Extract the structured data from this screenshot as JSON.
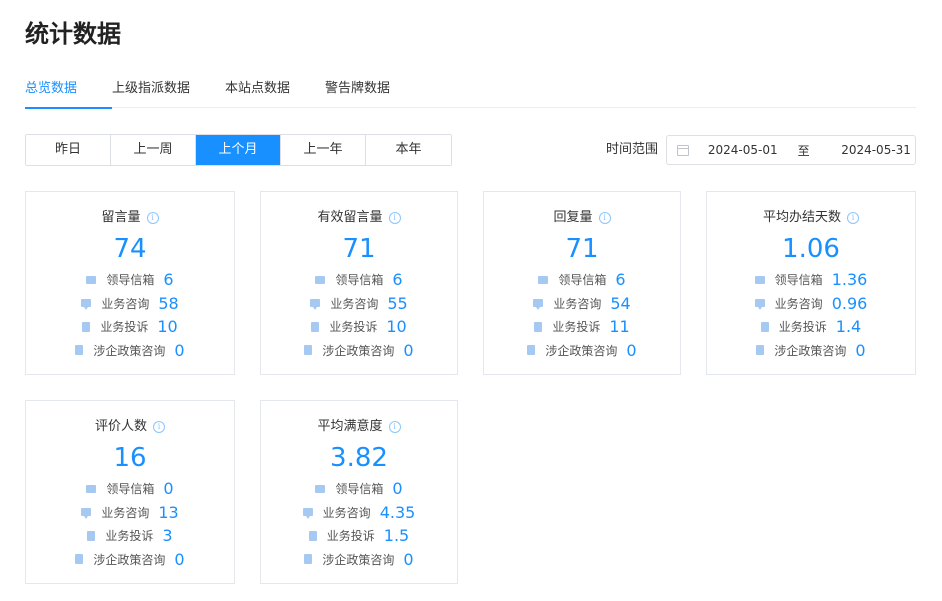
{
  "page": {
    "title": "统计数据"
  },
  "tabs": [
    {
      "label": "总览数据",
      "active": true
    },
    {
      "label": "上级指派数据",
      "active": false
    },
    {
      "label": "本站点数据",
      "active": false
    },
    {
      "label": "警告牌数据",
      "active": false
    }
  ],
  "period_buttons": [
    {
      "label": "昨日",
      "active": false
    },
    {
      "label": "上一周",
      "active": false
    },
    {
      "label": "上个月",
      "active": true
    },
    {
      "label": "上一年",
      "active": false
    },
    {
      "label": "本年",
      "active": false
    }
  ],
  "date_range": {
    "label": "时间范围",
    "start": "2024-05-01",
    "separator": "至",
    "end": "2024-05-31"
  },
  "colors": {
    "accent": "#1890ff",
    "border": "#e4e7ed",
    "icon": "#a6c9f2"
  },
  "row_icons": [
    "mail-icon",
    "chat-icon",
    "document-icon",
    "file-icon"
  ],
  "cards": [
    {
      "title": "留言量",
      "value": "74",
      "rows": [
        {
          "label": "领导信箱",
          "value": "6"
        },
        {
          "label": "业务咨询",
          "value": "58"
        },
        {
          "label": "业务投诉",
          "value": "10"
        },
        {
          "label": "涉企政策咨询",
          "value": "0"
        }
      ]
    },
    {
      "title": "有效留言量",
      "value": "71",
      "rows": [
        {
          "label": "领导信箱",
          "value": "6"
        },
        {
          "label": "业务咨询",
          "value": "55"
        },
        {
          "label": "业务投诉",
          "value": "10"
        },
        {
          "label": "涉企政策咨询",
          "value": "0"
        }
      ]
    },
    {
      "title": "回复量",
      "value": "71",
      "rows": [
        {
          "label": "领导信箱",
          "value": "6"
        },
        {
          "label": "业务咨询",
          "value": "54"
        },
        {
          "label": "业务投诉",
          "value": "11"
        },
        {
          "label": "涉企政策咨询",
          "value": "0"
        }
      ]
    },
    {
      "title": "平均办结天数",
      "value": "1.06",
      "rows": [
        {
          "label": "领导信箱",
          "value": "1.36"
        },
        {
          "label": "业务咨询",
          "value": "0.96"
        },
        {
          "label": "业务投诉",
          "value": "1.4"
        },
        {
          "label": "涉企政策咨询",
          "value": "0"
        }
      ]
    },
    {
      "title": "评价人数",
      "value": "16",
      "rows": [
        {
          "label": "领导信箱",
          "value": "0"
        },
        {
          "label": "业务咨询",
          "value": "13"
        },
        {
          "label": "业务投诉",
          "value": "3"
        },
        {
          "label": "涉企政策咨询",
          "value": "0"
        }
      ]
    },
    {
      "title": "平均满意度",
      "value": "3.82",
      "rows": [
        {
          "label": "领导信箱",
          "value": "0"
        },
        {
          "label": "业务咨询",
          "value": "4.35"
        },
        {
          "label": "业务投诉",
          "value": "1.5"
        },
        {
          "label": "涉企政策咨询",
          "value": "0"
        }
      ]
    }
  ]
}
